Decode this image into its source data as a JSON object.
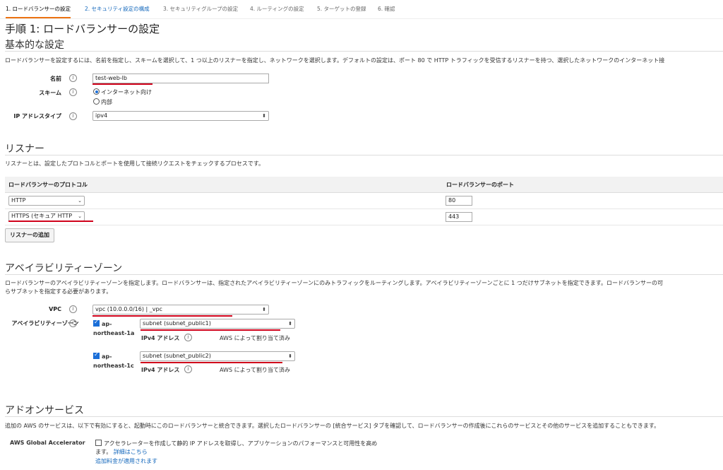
{
  "steps": [
    {
      "label": "1. ロードバランサーの設定"
    },
    {
      "label": "2. セキュリティ設定の構成"
    },
    {
      "label": "3. セキュリティグループの設定"
    },
    {
      "label": "4. ルーティングの設定"
    },
    {
      "label": "5. ターゲットの登録"
    },
    {
      "label": "6. 確認"
    }
  ],
  "page_title": "手順 1: ロードバランサーの設定",
  "basic": {
    "heading": "基本的な設定",
    "description": "ロードバランサーを設定するには、名前を指定し、スキームを選択して、1 つ以上のリスナーを指定し、ネットワークを選択します。デフォルトの設定は、ポート 80 で HTTP トラフィックを受信するリスナーを持つ、選択したネットワークのインターネット接",
    "name_label": "名前",
    "name_value": "test-web-lb",
    "scheme_label": "スキーム",
    "scheme_option_internet": "インターネット向け",
    "scheme_option_internal": "内部",
    "ip_label": "IP アドレスタイプ",
    "ip_value": "ipv4",
    "info_icon": "i"
  },
  "listener": {
    "heading": "リスナー",
    "description": "リスナーとは、設定したプロトコルとポートを使用して接続リクエストをチェックするプロセスです。",
    "col_protocol": "ロードバランサーのプロトコル",
    "col_port": "ロードバランサーのポート",
    "rows": [
      {
        "protocol": "HTTP",
        "port": "80"
      },
      {
        "protocol": "HTTPS (セキュア HTTP",
        "port": "443"
      }
    ],
    "add_button": "リスナーの追加"
  },
  "az": {
    "heading": "アベイラビリティーゾーン",
    "description_line1": "ロードバランサーのアベイラビリティーゾーンを指定します。ロードバランサーは、指定されたアベイラビリティーゾーンにのみトラフィックをルーティングします。アベイラビリティーゾーンごとに 1 つだけサブネットを指定できます。ロードバランサーの可",
    "description_line2": "らサブネットを指定する必要があります。",
    "vpc_label": "VPC",
    "vpc_value": "vpc                               (10.0.0.0/16) |        _vpc",
    "az_label": "アベイラビリティーゾーン",
    "zones": [
      {
        "name_line1": "ap-",
        "name_line2": "northeast-1a",
        "subnet": "subnet                              (subnet_public1)",
        "ip_label": "IPv4 アドレス",
        "ip_value": "AWS によって割り当て済み"
      },
      {
        "name_line1": "ap-",
        "name_line2": "northeast-1c",
        "subnet": "subnet                              (subnet_public2)",
        "ip_label": "IPv4 アドレス",
        "ip_value": "AWS によって割り当て済み"
      }
    ]
  },
  "addon": {
    "heading": "アドオンサービス",
    "description": "追加の AWS のサービスは、以下で有効にすると、起動時にこのロードバランサーと統合できます。選択したロードバランサーの [統合サービス] タブを確認して、ロードバランサーの作成後にこれらのサービスとその他のサービスを追加することもできます。",
    "ga_label": "AWS Global Accelerator",
    "ga_text_line1": "アクセラレーターを作成して静的 IP アドレスを取得し、アプリケーションのパフォーマンスと可用性を高め",
    "ga_text_line2": "ます。",
    "ga_link": "詳細はこちら",
    "ga_fee_link": "追加料金が適用されます"
  },
  "colors": {
    "accent": "#ec7211",
    "link": "#1166bb",
    "annotation": "#d0021b"
  }
}
